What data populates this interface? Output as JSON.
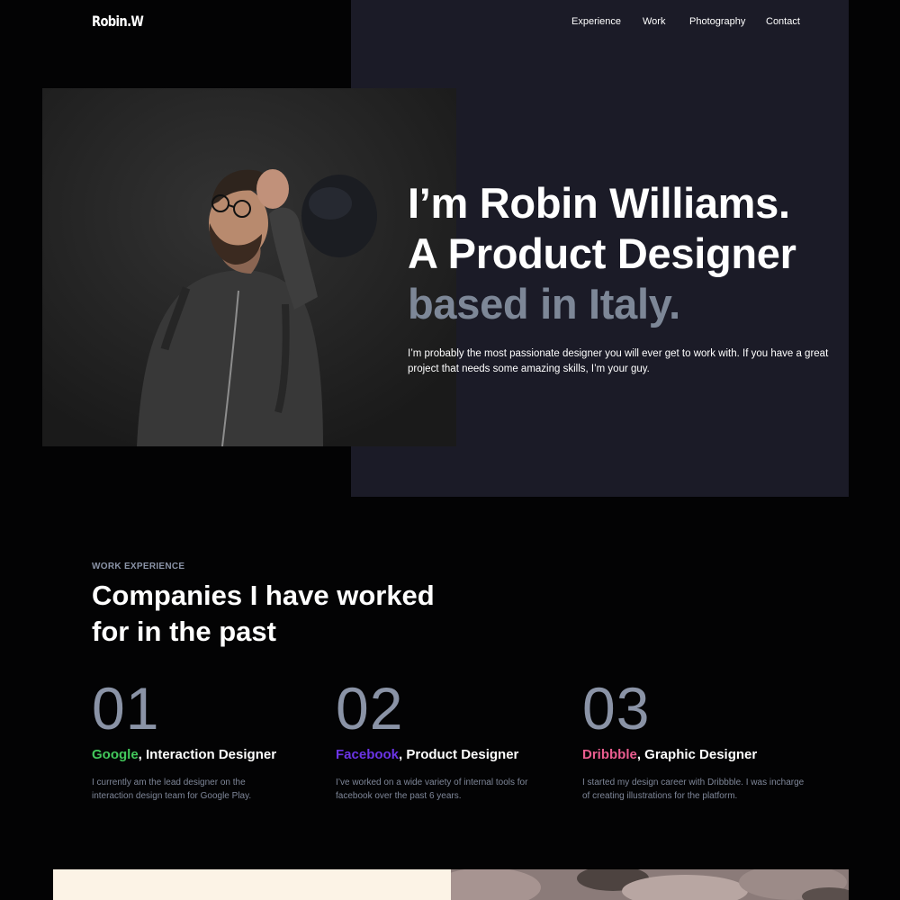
{
  "header": {
    "logo": "Robin.W",
    "nav": [
      "Experience",
      "Work",
      "Photography",
      "Contact"
    ]
  },
  "hero": {
    "heading_lines": [
      "I’m Robin Williams.",
      "A Product Designer",
      "based in Italy."
    ],
    "intro_lines": [
      "I’m probably the most passionate designer you will ever get to work with. If you have a great",
      "project that needs some amazing skills, I’m your guy."
    ]
  },
  "experience": {
    "label": "WORK EXPERIENCE",
    "heading_lines": [
      "Companies I have worked",
      "for in the past"
    ],
    "jobs": [
      {
        "number": "01",
        "company": "Google",
        "company_color": "#42c85b",
        "role": ", Interaction Designer",
        "description_lines": [
          "I currently am the lead designer on the",
          "interaction design team for Google Play."
        ]
      },
      {
        "number": "02",
        "company": "Facebook",
        "company_color": "#6b34e6",
        "role": ", Product Designer",
        "description_lines": [
          "I’ve worked on a wide variety of internal tools for",
          "facebook over the past 6 years."
        ]
      },
      {
        "number": "03",
        "company": "Dribbble",
        "company_color": "#ea5d8f",
        "role": ", Graphic Designer",
        "description_lines": [
          "I started my design career with Dribbble. I was incharge",
          "of creating illustrations for the platform."
        ]
      }
    ]
  },
  "colors": {
    "background": "#030304",
    "hero_panel": "#1b1b27",
    "muted_text": "#7d8797"
  }
}
